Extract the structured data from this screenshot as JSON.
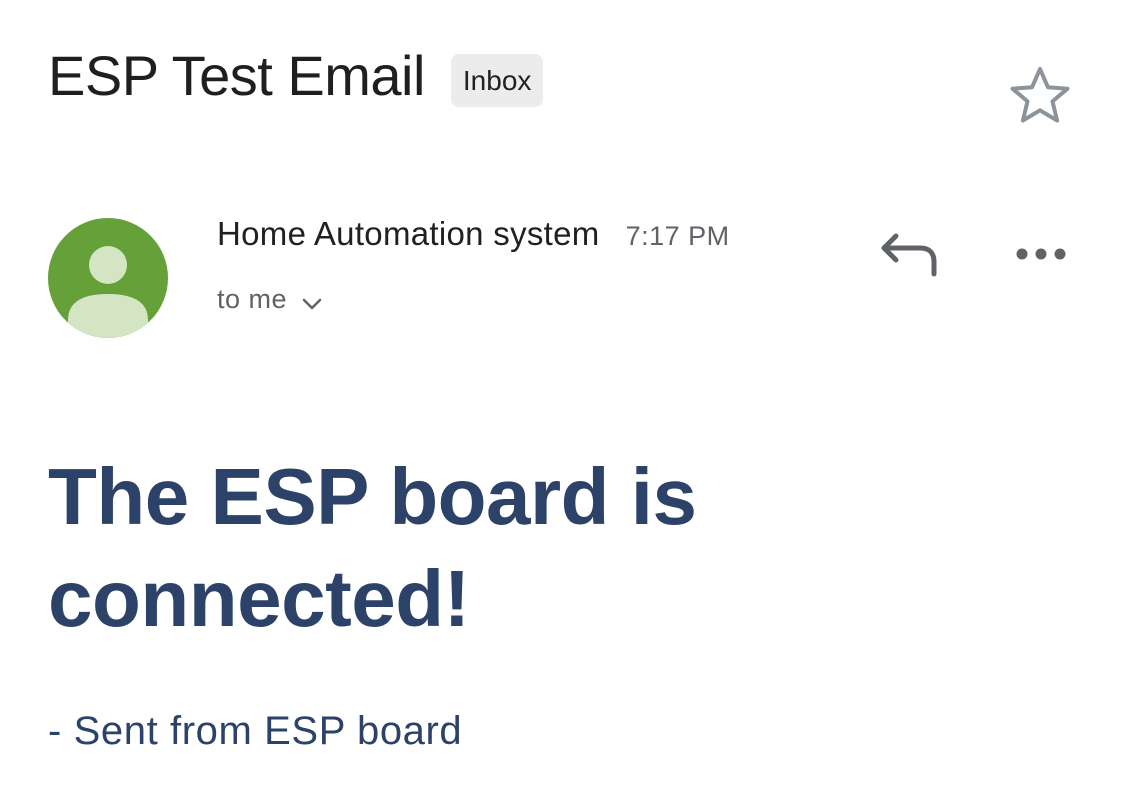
{
  "email": {
    "subject": "ESP Test Email",
    "label": "Inbox",
    "sender": "Home Automation system",
    "time": "7:17 PM",
    "recipient": "to me",
    "body_heading": "The ESP board is connected!",
    "body_signature": "- Sent from ESP board"
  },
  "icons": {
    "star": "star-outline-icon",
    "avatar": "person-avatar-icon",
    "chevron": "chevron-down-icon",
    "reply": "reply-icon",
    "more": "more-horizontal-icon"
  },
  "colors": {
    "avatar_bg": "#66a039",
    "avatar_figure": "#d3e5c3",
    "body_text": "#2c4268",
    "chip_bg": "#ececec",
    "icon_gray": "#5f6368",
    "star_gray": "#8d939b"
  }
}
